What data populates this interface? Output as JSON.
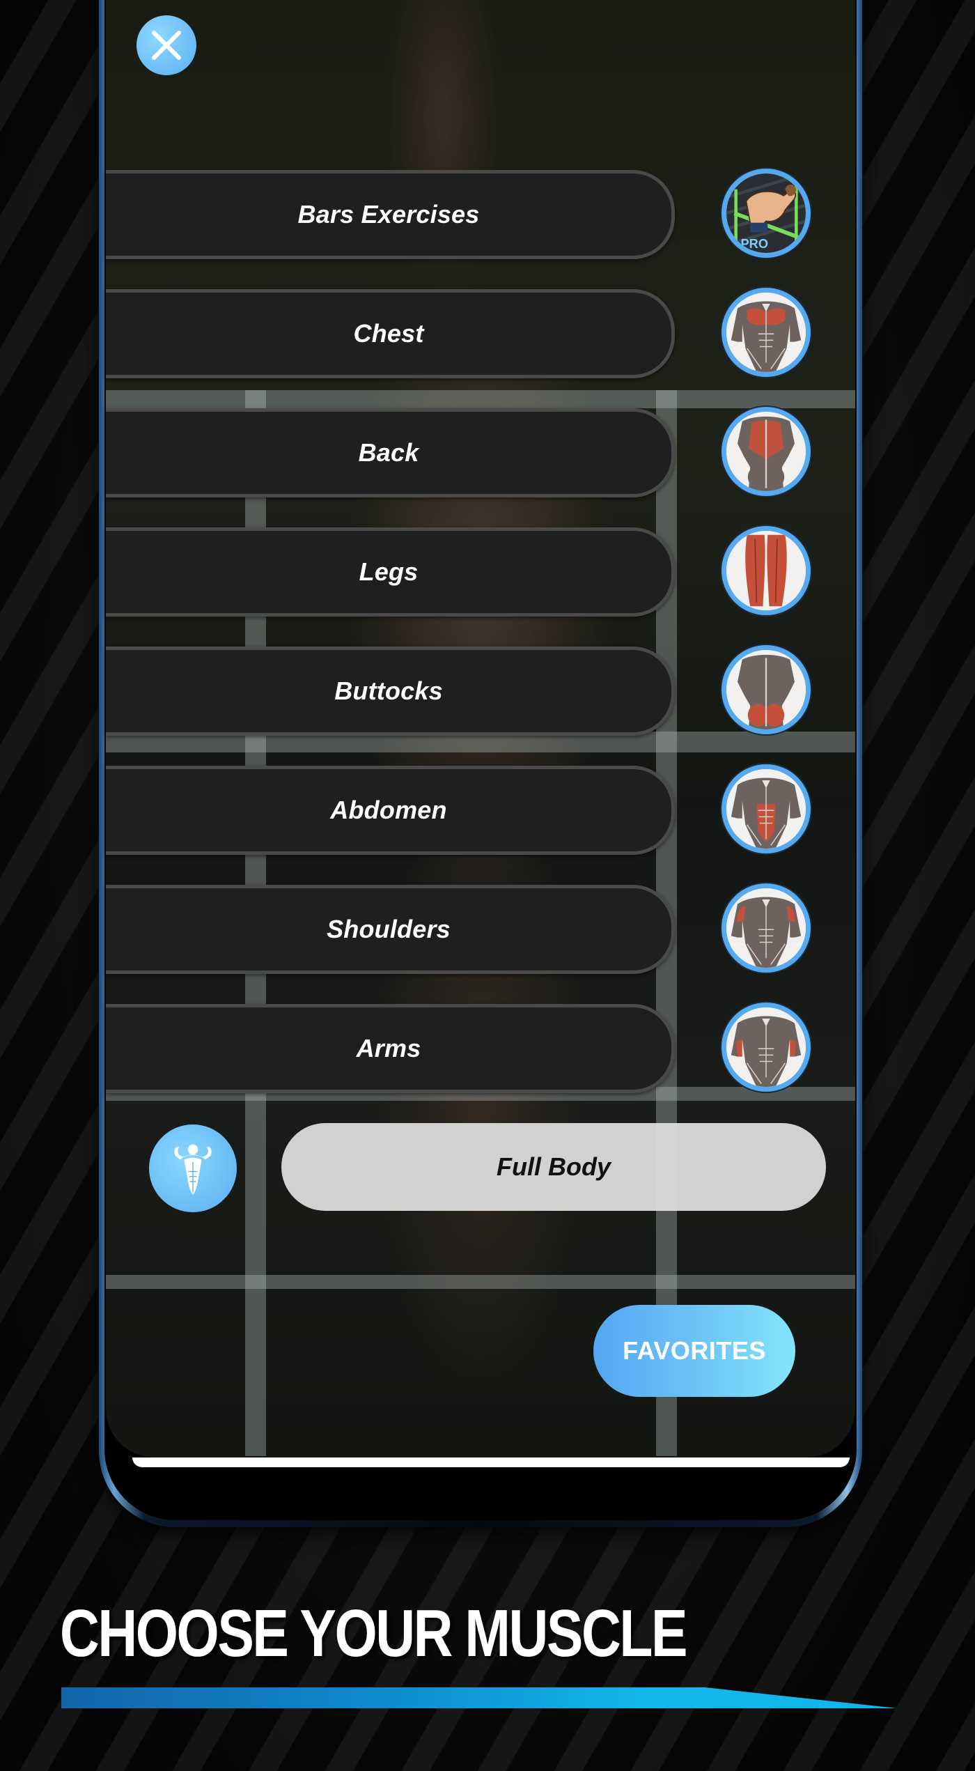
{
  "screen": {
    "close_button": {
      "icon": "close-icon"
    },
    "menu_items": [
      {
        "label": "Bars Exercises",
        "icon": "bars-exercises-pro-icon",
        "highlight": "bars"
      },
      {
        "label": "Chest",
        "icon": "chest-muscle-icon",
        "highlight": "chest"
      },
      {
        "label": "Back",
        "icon": "back-muscle-icon",
        "highlight": "back"
      },
      {
        "label": "Legs",
        "icon": "legs-muscle-icon",
        "highlight": "legs"
      },
      {
        "label": "Buttocks",
        "icon": "buttocks-muscle-icon",
        "highlight": "buttocks"
      },
      {
        "label": "Abdomen",
        "icon": "abdomen-muscle-icon",
        "highlight": "abdomen"
      },
      {
        "label": "Shoulders",
        "icon": "shoulders-muscle-icon",
        "highlight": "shoulders"
      },
      {
        "label": "Arms",
        "icon": "arms-muscle-icon",
        "highlight": "arms"
      }
    ],
    "full_body": {
      "label": "Full Body",
      "icon": "bodybuilder-icon"
    },
    "favorites_button": {
      "label": "FAVORITES"
    },
    "pro_badge": "PRO"
  },
  "promo": {
    "headline": "CHOOSE YOUR MUSCLE"
  },
  "colors": {
    "accent_blue": "#55a9ee",
    "pill_dark": "#1f1f1f",
    "muscle_highlight": "#c4503c",
    "favorites_gradient_start": "#55a6f2",
    "favorites_gradient_end": "#83e4fb"
  }
}
